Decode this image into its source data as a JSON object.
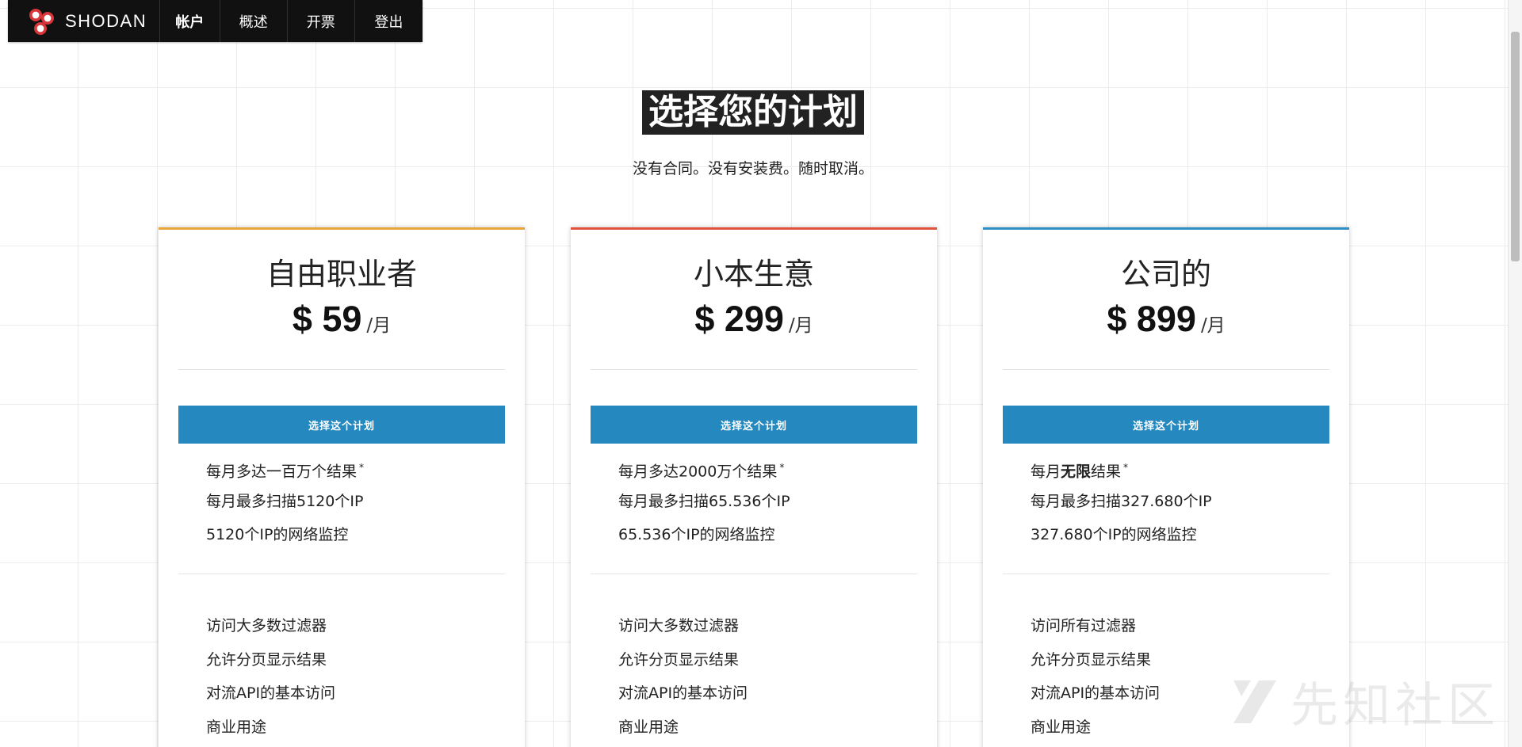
{
  "nav": {
    "brand": "SHODAN",
    "items": [
      "帐户",
      "概述",
      "开票",
      "登出"
    ]
  },
  "header": {
    "title": "选择您的计划",
    "subtitle": "没有合同。没有安装费。随时取消。"
  },
  "plans": [
    {
      "name": "自由职业者",
      "price": "$ 59",
      "period": "/月",
      "accent": "#e8a53a",
      "button": "选择这个计划",
      "features_a": [
        {
          "pre": "每月多达一百万个结果",
          "bold": "",
          "post": "",
          "note": "*"
        },
        {
          "pre": "每月最多扫描5120个IP",
          "bold": "",
          "post": "",
          "note": ""
        },
        {
          "pre": "5120个IP的网络监控",
          "bold": "",
          "post": "",
          "note": ""
        }
      ],
      "features_b": [
        "访问大多数过滤器",
        "允许分页显示结果",
        "对流API的基本访问",
        "商业用途"
      ]
    },
    {
      "name": "小本生意",
      "price": "$ 299",
      "period": "/月",
      "accent": "#e2533f",
      "button": "选择这个计划",
      "features_a": [
        {
          "pre": "每月多达2000万个结果",
          "bold": "",
          "post": "",
          "note": "*"
        },
        {
          "pre": "每月最多扫描65.536个IP",
          "bold": "",
          "post": "",
          "note": ""
        },
        {
          "pre": "65.536个IP的网络监控",
          "bold": "",
          "post": "",
          "note": ""
        }
      ],
      "features_b": [
        "访问大多数过滤器",
        "允许分页显示结果",
        "对流API的基本访问",
        "商业用途"
      ]
    },
    {
      "name": "公司的",
      "price": "$ 899",
      "period": "/月",
      "accent": "#2f8fc4",
      "button": "选择这个计划",
      "features_a": [
        {
          "pre": "每月",
          "bold": "无限",
          "post": "结果",
          "note": "*"
        },
        {
          "pre": "每月最多扫描327.680个IP",
          "bold": "",
          "post": "",
          "note": ""
        },
        {
          "pre": "327.680个IP的网络监控",
          "bold": "",
          "post": "",
          "note": ""
        }
      ],
      "features_b": [
        "访问所有过滤器",
        "允许分页显示结果",
        "对流API的基本访问",
        "商业用途"
      ]
    }
  ],
  "watermark": {
    "text": "先知社区",
    "icon": "xianzhi-logo-icon"
  }
}
